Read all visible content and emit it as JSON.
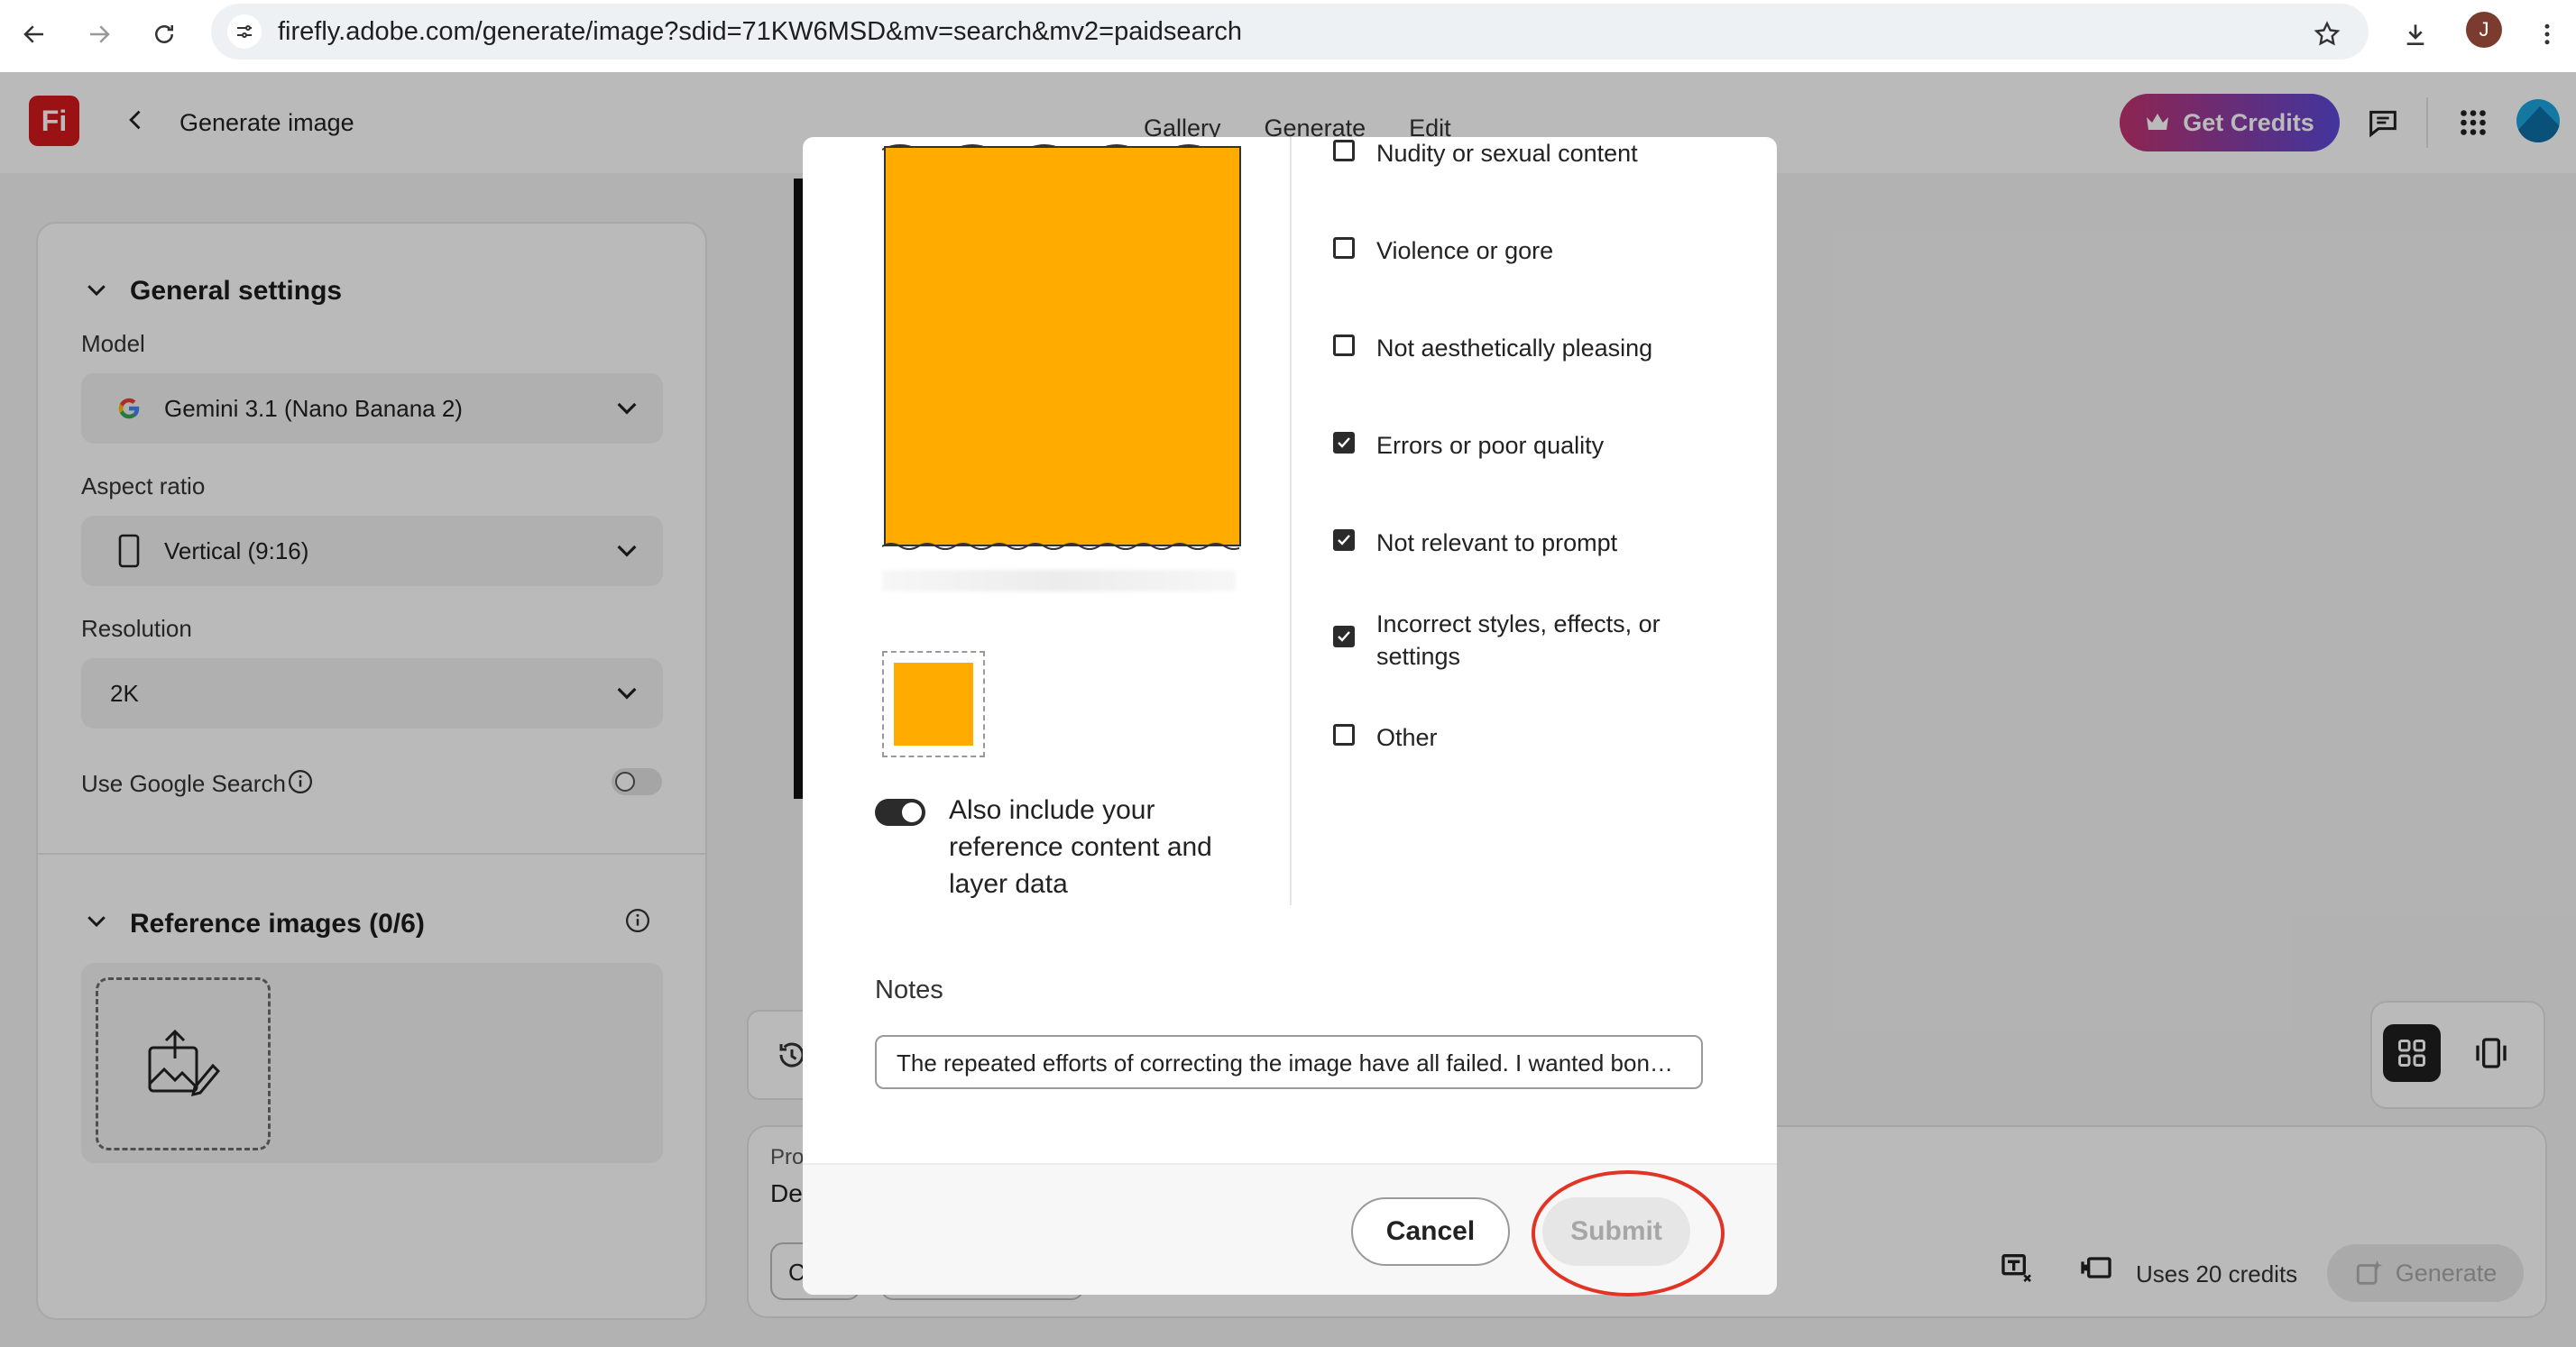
{
  "browser": {
    "url": "firefly.adobe.com/generate/image?sdid=71KW6MSD&mv=search&mv2=paidsearch",
    "avatar_letter": "J"
  },
  "appbar": {
    "logo_text": "Fi",
    "title": "Generate image",
    "tabs": [
      "Gallery",
      "Generate",
      "Edit"
    ],
    "credits_button": "Get Credits"
  },
  "left_panel": {
    "general_settings": "General settings",
    "model_label": "Model",
    "model_value": "Gemini 3.1 (Nano Banana 2)",
    "aspect_label": "Aspect ratio",
    "aspect_value": "Vertical (9:16)",
    "resolution_label": "Resolution",
    "resolution_value": "2K",
    "google_search_label": "Use Google Search",
    "reference_images": "Reference images (0/6)"
  },
  "prompt": {
    "label": "Pro",
    "text": "De",
    "chip": "C",
    "credits": "Uses 20 credits",
    "generate_button": "Generate"
  },
  "modal": {
    "toggle_label": "Also include your reference content and layer data",
    "options": [
      {
        "label": "Nudity or sexual content",
        "checked": false
      },
      {
        "label": "Violence or gore",
        "checked": false
      },
      {
        "label": "Not aesthetically pleasing",
        "checked": false
      },
      {
        "label": "Errors or poor quality",
        "checked": true
      },
      {
        "label": "Not relevant to prompt",
        "checked": true
      },
      {
        "label": "Incorrect styles, effects, or settings",
        "checked": true
      },
      {
        "label": "Other",
        "checked": false
      }
    ],
    "notes_label": "Notes",
    "notes_value": "The repeated efforts of correcting the image have all failed. I wanted bones...",
    "cancel_button": "Cancel",
    "submit_button": "Submit"
  },
  "colors": {
    "accent_orange": "#ffab00",
    "highlight_red": "#e33325",
    "brand_red": "#d4191b"
  }
}
